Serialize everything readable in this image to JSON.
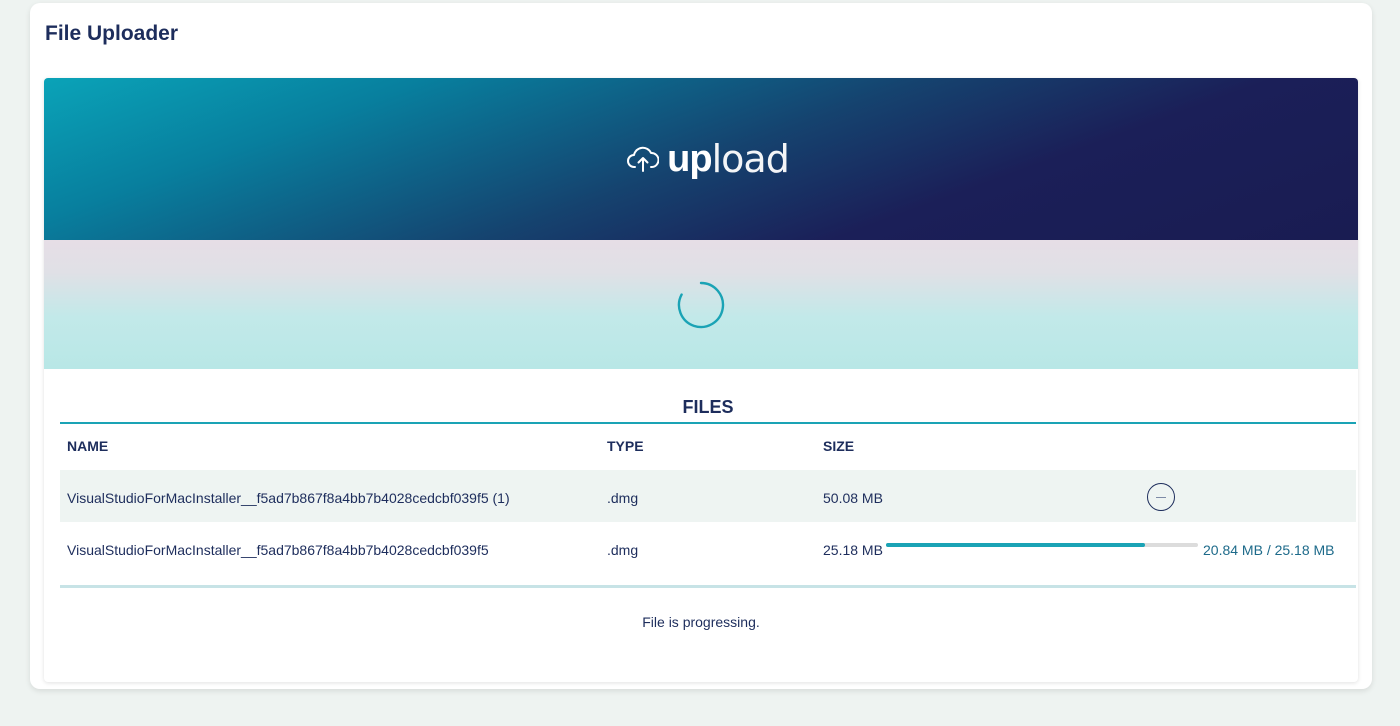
{
  "page": {
    "title": "File Uploader"
  },
  "banner": {
    "logo_bold": "up",
    "logo_light": "load",
    "icon": "cloud-upload-icon"
  },
  "dropzone": {
    "state_icon": "loading-spinner-icon"
  },
  "files": {
    "heading": "FILES",
    "columns": {
      "name": "NAME",
      "type": "TYPE",
      "size": "SIZE"
    },
    "rows": [
      {
        "name": "VisualStudioForMacInstaller__f5ad7b867f8a4bb7b4028cedcbf039f5 (1)",
        "type": ".dmg",
        "size": "50.08 MB",
        "action_icon": "cancel-circle-icon"
      },
      {
        "name": "VisualStudioForMacInstaller__f5ad7b867f8a4bb7b4028cedcbf039f5",
        "type": ".dmg",
        "size": "25.18 MB",
        "progress_fraction": 0.83,
        "progress_text": "20.84 MB / 25.18 MB"
      }
    ]
  },
  "status": {
    "message": "File is progressing."
  },
  "colors": {
    "accent": "#1aa3b5",
    "navy": "#1d2d5c",
    "banner_dark": "#191c52",
    "banner_light": "#0aa3b8"
  }
}
